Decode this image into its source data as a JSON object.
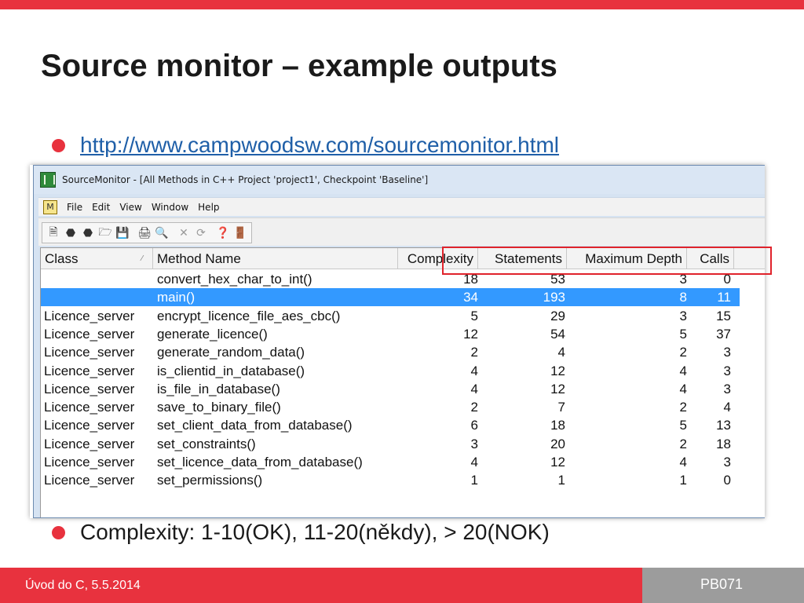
{
  "slide": {
    "title": "Source monitor – example outputs",
    "bullets": [
      "http://www.campwoodsw.com/sourcemonitor.html",
      "Complexity: 1-10(OK), 11-20(někdy), > 20(NOK)"
    ],
    "footer_left": "Úvod do C, 5.5.2014",
    "footer_right": "PB071",
    "accent_color": "#e8323e"
  },
  "window": {
    "title": "SourceMonitor - [All Methods in C++ Project 'project1', Checkpoint 'Baseline']",
    "menu_icon_label": "M",
    "menu": [
      "File",
      "Edit",
      "View",
      "Window",
      "Help"
    ],
    "toolbar_icons": [
      "new-doc-icon",
      "open-icon",
      "folder-open-icon",
      "save-icon",
      "print-icon",
      "print-preview-icon",
      "delete-icon",
      "refresh-icon",
      "help-pointer-icon",
      "exit-door-icon"
    ]
  },
  "table": {
    "columns": [
      "Class",
      "Method Name",
      "Complexity",
      "Statements",
      "Maximum Depth",
      "Calls"
    ],
    "selected_row": 1,
    "selection_color": "#3399ff",
    "rows": [
      {
        "class": "",
        "method": "convert_hex_char_to_int()",
        "complexity": "18",
        "statements": "53",
        "depth": "3",
        "calls": "0"
      },
      {
        "class": "",
        "method": "main()",
        "complexity": "34",
        "statements": "193",
        "depth": "8",
        "calls": "11"
      },
      {
        "class": "Licence_server",
        "method": "encrypt_licence_file_aes_cbc()",
        "complexity": "5",
        "statements": "29",
        "depth": "3",
        "calls": "15"
      },
      {
        "class": "Licence_server",
        "method": "generate_licence()",
        "complexity": "12",
        "statements": "54",
        "depth": "5",
        "calls": "37"
      },
      {
        "class": "Licence_server",
        "method": "generate_random_data()",
        "complexity": "2",
        "statements": "4",
        "depth": "2",
        "calls": "3"
      },
      {
        "class": "Licence_server",
        "method": "is_clientid_in_database()",
        "complexity": "4",
        "statements": "12",
        "depth": "4",
        "calls": "3"
      },
      {
        "class": "Licence_server",
        "method": "is_file_in_database()",
        "complexity": "4",
        "statements": "12",
        "depth": "4",
        "calls": "3"
      },
      {
        "class": "Licence_server",
        "method": "save_to_binary_file()",
        "complexity": "2",
        "statements": "7",
        "depth": "2",
        "calls": "4"
      },
      {
        "class": "Licence_server",
        "method": "set_client_data_from_database()",
        "complexity": "6",
        "statements": "18",
        "depth": "5",
        "calls": "13"
      },
      {
        "class": "Licence_server",
        "method": "set_constraints()",
        "complexity": "3",
        "statements": "20",
        "depth": "2",
        "calls": "18"
      },
      {
        "class": "Licence_server",
        "method": "set_licence_data_from_database()",
        "complexity": "4",
        "statements": "12",
        "depth": "4",
        "calls": "3"
      },
      {
        "class": "Licence_server",
        "method": "set_permissions()",
        "complexity": "1",
        "statements": "1",
        "depth": "1",
        "calls": "0"
      }
    ]
  }
}
